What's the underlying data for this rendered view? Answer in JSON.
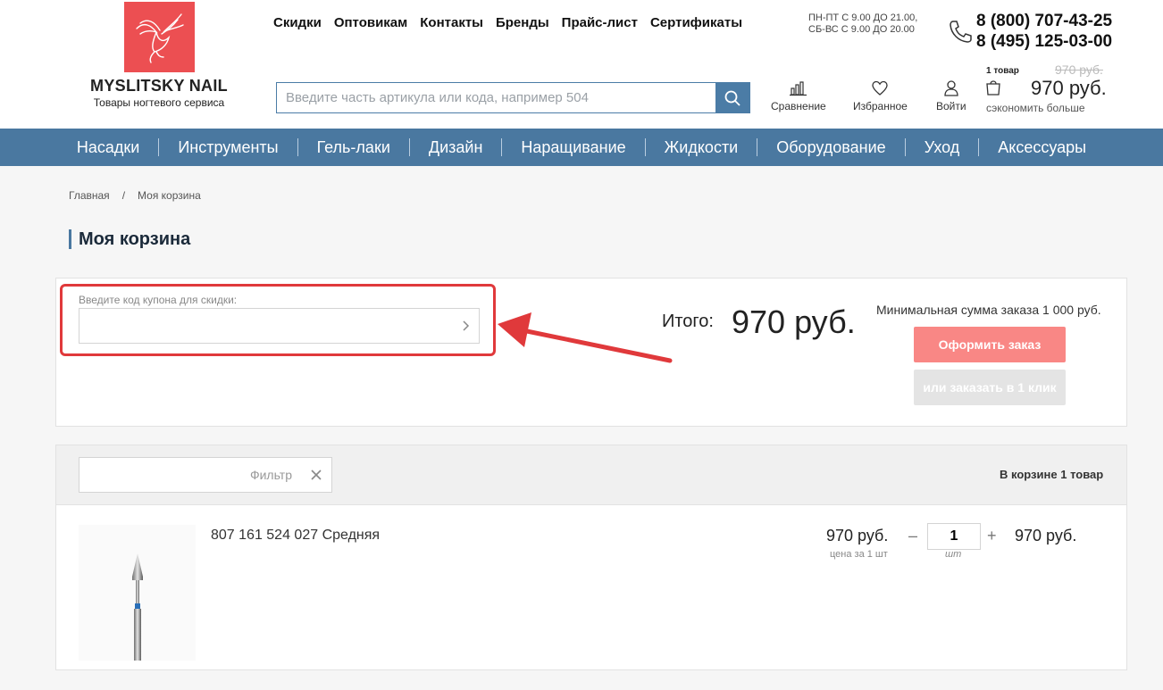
{
  "brand": {
    "name": "MYSLITSKY NAIL",
    "tagline": "Товары ногтевого сервиса",
    "logo_color": "#ec4f52"
  },
  "topnav": [
    "Скидки",
    "Оптовикам",
    "Контакты",
    "Бренды",
    "Прайс-лист",
    "Сертификаты"
  ],
  "hours": {
    "weekdays": "ПН-ПТ С 9.00 ДО 21.00,",
    "weekend": "СБ-ВС С 9.00 ДО 20.00"
  },
  "phones": [
    "8 (800) 707-43-25",
    "8 (495) 125-03-00"
  ],
  "search": {
    "placeholder": "Введите часть артикула или кода, например 504",
    "value": ""
  },
  "header_actions": {
    "compare": "Сравнение",
    "favorites": "Избранное",
    "login": "Войти"
  },
  "mini_cart": {
    "count": "1 товар",
    "old_price": "970 руб.",
    "price": "970 руб.",
    "save_more": "сэкономить больше"
  },
  "categories": [
    "Насадки",
    "Инструменты",
    "Гель-лаки",
    "Дизайн",
    "Наращивание",
    "Жидкости",
    "Оборудование",
    "Уход",
    "Аксессуары"
  ],
  "breadcrumbs": {
    "home": "Главная",
    "separator": "/",
    "current": "Моя корзина"
  },
  "page_title": "Моя корзина",
  "summary": {
    "coupon_label": "Введите код купона для скидки:",
    "coupon_value": "",
    "total_label": "Итого:",
    "total_value": "970 руб.",
    "min_sum": "Минимальная сумма заказа 1 000 руб.",
    "order_button": "Оформить заказ",
    "one_click_button": "или заказать в 1 клик"
  },
  "cart": {
    "filter_placeholder": "Фильтр",
    "count_prefix": "В корзине",
    "count_number": "1",
    "count_suffix": "товар",
    "items": [
      {
        "name": "807 161 524 027 Средняя",
        "unit_price": "970 руб.",
        "unit_note": "цена за 1 шт",
        "quantity": "1",
        "unit": "шт",
        "total": "970 руб."
      }
    ]
  },
  "colors": {
    "accent": "#4a78a0",
    "highlight": "#e0393b",
    "order_button": "#f98785"
  }
}
